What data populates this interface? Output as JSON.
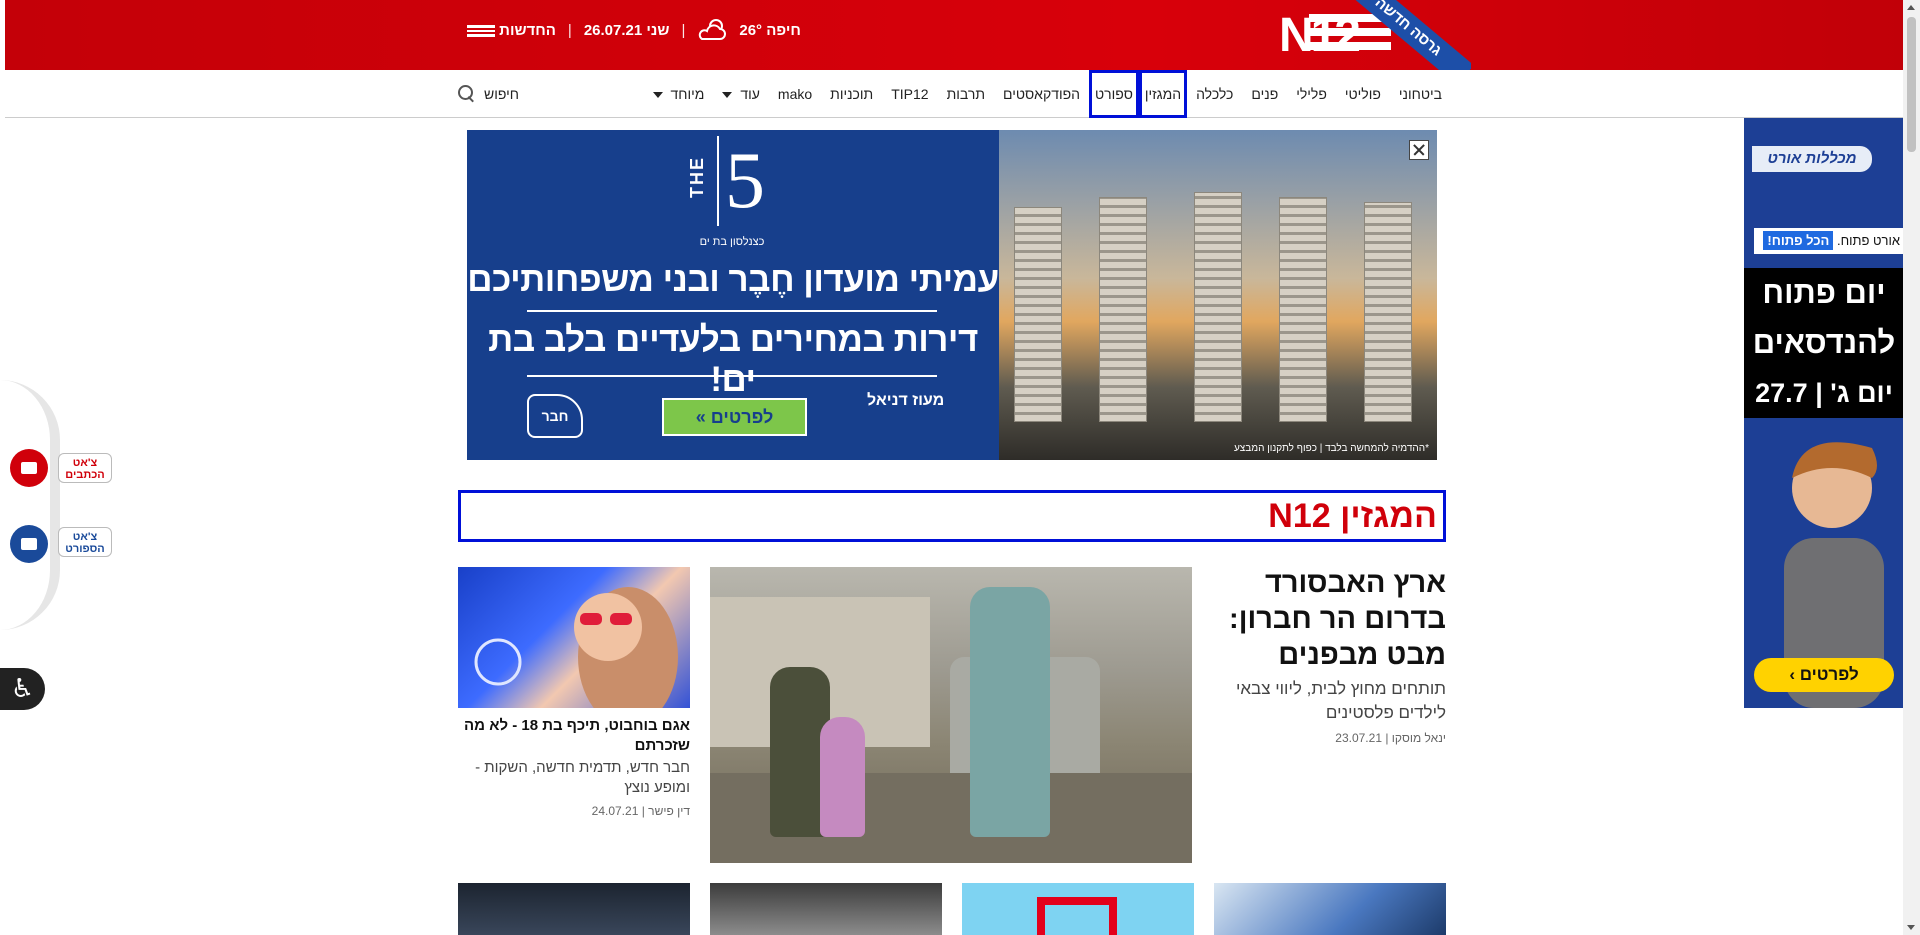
{
  "topbar": {
    "logo_text": "N12",
    "ribbon_text": "גרסה חדשה",
    "city": "חיפה",
    "temperature": "26°",
    "day": "שני",
    "date": "26.07.21",
    "news_label": "החדשות"
  },
  "nav": {
    "items": [
      {
        "label": "ביטחוני"
      },
      {
        "label": "פוליטי"
      },
      {
        "label": "פלילי"
      },
      {
        "label": "פנים"
      },
      {
        "label": "כלכלה"
      },
      {
        "label": "המגזין"
      },
      {
        "label": "ספורט"
      },
      {
        "label": "הפודקאסטים"
      },
      {
        "label": "תרבות"
      },
      {
        "label": "TIP12"
      },
      {
        "label": "תוכניות"
      },
      {
        "label": "mako"
      },
      {
        "label": "עוד"
      },
      {
        "label": "מיוחד"
      }
    ],
    "search_label": "חיפוש"
  },
  "ad_main": {
    "brand_the": "THE",
    "brand_five": "5",
    "brand_sub": "כצנלסון בת ים",
    "headline_1": "עמיתי מועדון חֶבֶר ובני משפחותיכם",
    "headline_2": "דירות במחירים בלעדיים בלב בת ים!",
    "button_label": "לפרטים »",
    "logo_right": "מעוז דניאל",
    "logo_left": "חבר",
    "photo_caption": "*ההדמיה להמחשה בלבד | כפוף לתקנון המבצע"
  },
  "side_widgets": {
    "chat_writers": "צ'אט הכתבים",
    "chat_sport": "צ'אט הספורט",
    "accessibility_icon": "accessibility-icon"
  },
  "ad_side": {
    "logo": "מכללות אורט",
    "tag_1": "אורט פתוח.",
    "tag_2": "הכל פתוח!",
    "line_1": "יום פתוח",
    "line_2": "להנדסאים",
    "line_3": "יום ג' | 27.7",
    "cta": "לפרטים ›"
  },
  "section": {
    "title": "המגזין N12"
  },
  "lead_article": {
    "title": "ארץ האבסורד בדרום הר חברון: מבט מבפנים",
    "subtitle": "תותחים מחוץ לבית, ליווי צבאי לילדים פלסטינים",
    "author": "ינאל מוסקו",
    "date": "23.07.21"
  },
  "side_article": {
    "title": "אגם בוחבוט, תיכף בת 18 - לא מה שזכרתם",
    "subtitle": "חבר חדש, תדמית חדשה, השקות - ומופע נוצץ",
    "author": "דין פישר",
    "date": "24.07.21"
  }
}
